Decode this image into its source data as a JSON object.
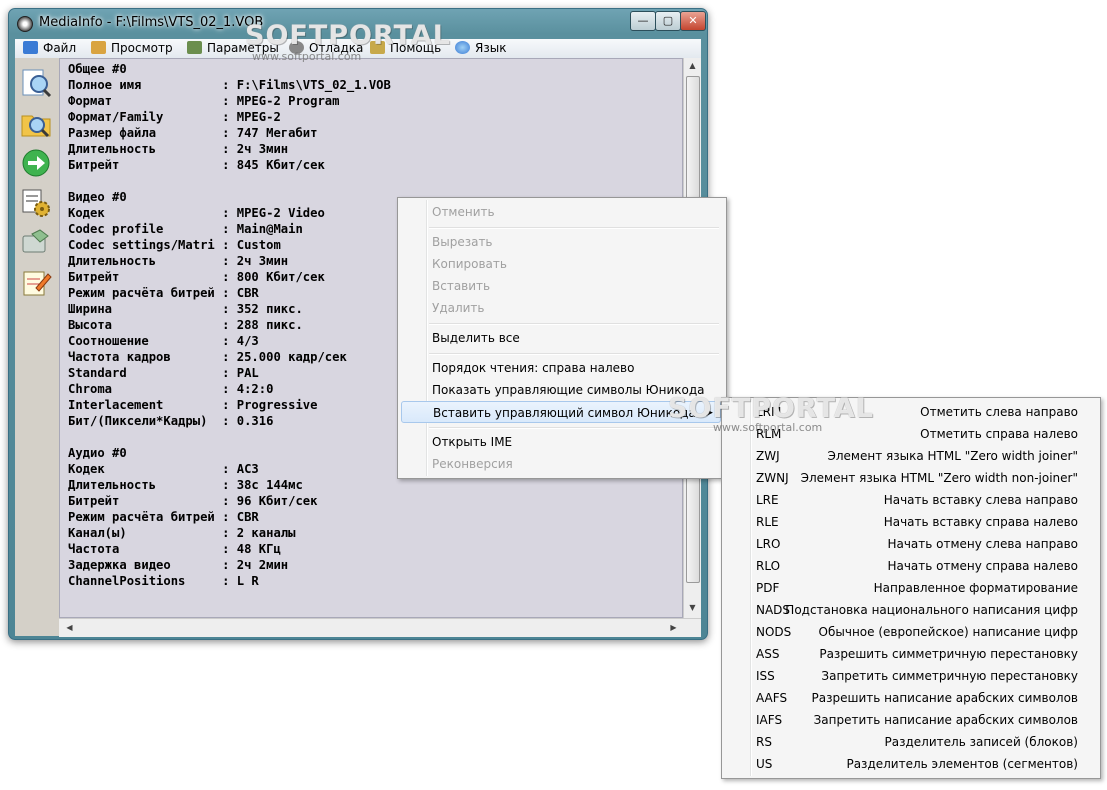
{
  "window": {
    "title": "MediaInfo - F:\\Films\\VTS_02_1.VOB",
    "controls": {
      "minimize": "—",
      "maximize": "▢",
      "close": "✕"
    }
  },
  "menu": [
    {
      "label": "Файл",
      "icon": "folder-icon",
      "color": "#3a7bd5"
    },
    {
      "label": "Просмотр",
      "icon": "pencil-icon",
      "color": "#d9a441"
    },
    {
      "label": "Параметры",
      "icon": "settings-icon",
      "color": "#6b8e4e"
    },
    {
      "label": "Отладка",
      "icon": "debug-icon",
      "color": "#888888"
    },
    {
      "label": "Помощь",
      "icon": "help-icon",
      "color": "#c7a94a"
    },
    {
      "label": "Язык",
      "icon": "globe-icon",
      "color": "#3a7bd5"
    }
  ],
  "sidebar_icons": [
    "magnifier-document-icon",
    "magnifier-folder-icon",
    "green-arrow-icon",
    "gear-tools-icon",
    "export-icon",
    "notepad-icon"
  ],
  "report_lines": [
    "Общее #0",
    "Полное имя           : F:\\Films\\VTS_02_1.VOB",
    "Формат               : MPEG-2 Program",
    "Формат/Family        : MPEG-2",
    "Размер файла         : 747 Мегабит",
    "Длительность         : 2ч 3мин",
    "Битрейт              : 845 Кбит/сек",
    "",
    "Видео #0",
    "Кодек                : MPEG-2 Video",
    "Codec profile        : Main@Main",
    "Codec settings/Matri : Custom",
    "Длительность         : 2ч 3мин",
    "Битрейт              : 800 Кбит/сек",
    "Режим расчёта битрей : CBR",
    "Ширина               : 352 пикс.",
    "Высота               : 288 пикс.",
    "Соотношение          : 4/3",
    "Частота кадров       : 25.000 кадр/сек",
    "Standard             : PAL",
    "Chroma               : 4:2:0",
    "Interlacement        : Progressive",
    "Бит/(Пиксели*Кадры)  : 0.316",
    "",
    "Аудио #0",
    "Кодек                : AC3",
    "Длительность         : 38с 144мс",
    "Битрейт              : 96 Кбит/сек",
    "Режим расчёта битрей : CBR",
    "Канал(ы)             : 2 каналы",
    "Частота              : 48 КГц",
    "Задержка видео       : 2ч 2мин",
    "ChannelPositions     : L R"
  ],
  "context_menu": {
    "items": [
      {
        "label": "Отменить",
        "disabled": true
      },
      {
        "label": "Вырезать",
        "disabled": true
      },
      {
        "label": "Копировать",
        "disabled": true
      },
      {
        "label": "Вставить",
        "disabled": true
      },
      {
        "label": "Удалить",
        "disabled": true
      },
      {
        "label": "Выделить все",
        "disabled": false
      },
      {
        "label": "Порядок чтения: справа налево",
        "disabled": false
      },
      {
        "label": "Показать управляющие символы Юникода",
        "disabled": false
      },
      {
        "label": "Вставить управляющий символ Юникода",
        "disabled": false,
        "submenu": true
      },
      {
        "label": "Открыть IME",
        "disabled": false
      },
      {
        "label": "Реконверсия",
        "disabled": true
      }
    ],
    "submenu_arrow": "▶"
  },
  "unicode_submenu": [
    {
      "code": "LRM",
      "desc": "Отметить слева направо"
    },
    {
      "code": "RLM",
      "desc": "Отметить справа налево"
    },
    {
      "code": "ZWJ",
      "desc": "Элемент языка HTML \"Zero width joiner\""
    },
    {
      "code": "ZWNJ",
      "desc": "Элемент языка HTML \"Zero width non-joiner\""
    },
    {
      "code": "LRE",
      "desc": "Начать вставку слева направо"
    },
    {
      "code": "RLE",
      "desc": "Начать вставку справа налево"
    },
    {
      "code": "LRO",
      "desc": "Начать отмену слева направо"
    },
    {
      "code": "RLO",
      "desc": "Начать отмену справа налево"
    },
    {
      "code": "PDF",
      "desc": "Направленное форматирование"
    },
    {
      "code": "NADS",
      "desc": "Подстановка национального написания цифр"
    },
    {
      "code": "NODS",
      "desc": "Обычное (европейское) написание цифр"
    },
    {
      "code": "ASS",
      "desc": "Разрешить симметричную перестановку"
    },
    {
      "code": "ISS",
      "desc": "Запретить симметричную перестановку"
    },
    {
      "code": "AAFS",
      "desc": "Разрешить написание арабских символов"
    },
    {
      "code": "IAFS",
      "desc": "Запретить написание арабских символов"
    },
    {
      "code": "RS",
      "desc": "Разделитель записей (блоков)"
    },
    {
      "code": "US",
      "desc": "Разделитель элементов (сегментов)"
    }
  ],
  "watermark": {
    "brand": "SOFTPORTAL",
    "url": "www.softportal.com"
  },
  "scroll": {
    "up": "▲",
    "down": "▼",
    "left": "◀",
    "right": "▶"
  }
}
